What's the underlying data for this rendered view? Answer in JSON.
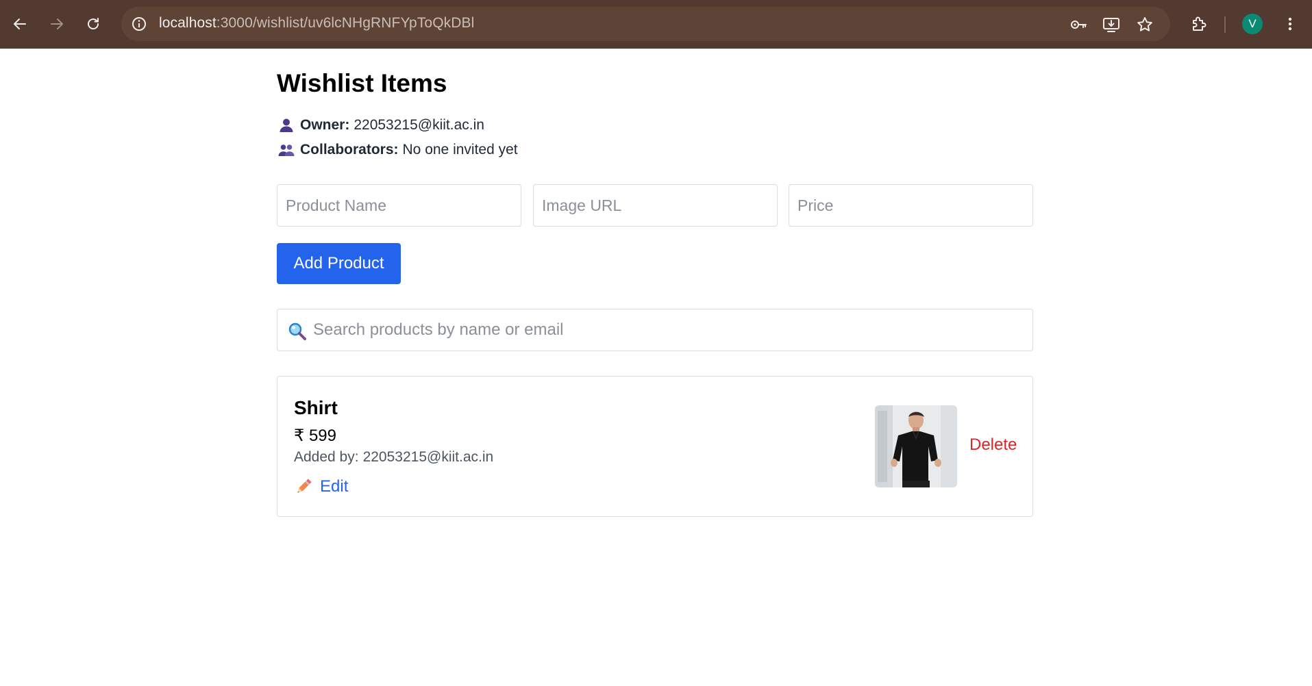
{
  "browser": {
    "url_host": "localhost",
    "url_rest": ":3000/wishlist/uv6lcNHgRNFYpToQkDBl",
    "profile_initial": "V",
    "toolbar_bg": "#533a30"
  },
  "page": {
    "title": "Wishlist Items",
    "owner_label": "Owner:",
    "owner_value": "22053215@kiit.ac.in",
    "collaborators_label": "Collaborators:",
    "collaborators_value": "No one invited yet"
  },
  "form": {
    "product_name_placeholder": "Product Name",
    "image_url_placeholder": "Image URL",
    "price_placeholder": "Price",
    "add_button_label": "Add Product",
    "accent_color": "#2463eb"
  },
  "search": {
    "placeholder": "Search products by name or email"
  },
  "products": [
    {
      "name": "Shirt",
      "price": "₹ 599",
      "added_by_label": "Added by:",
      "added_by_value": "22053215@kiit.ac.in",
      "edit_label": "Edit",
      "delete_label": "Delete",
      "delete_color": "#dc2626"
    }
  ]
}
